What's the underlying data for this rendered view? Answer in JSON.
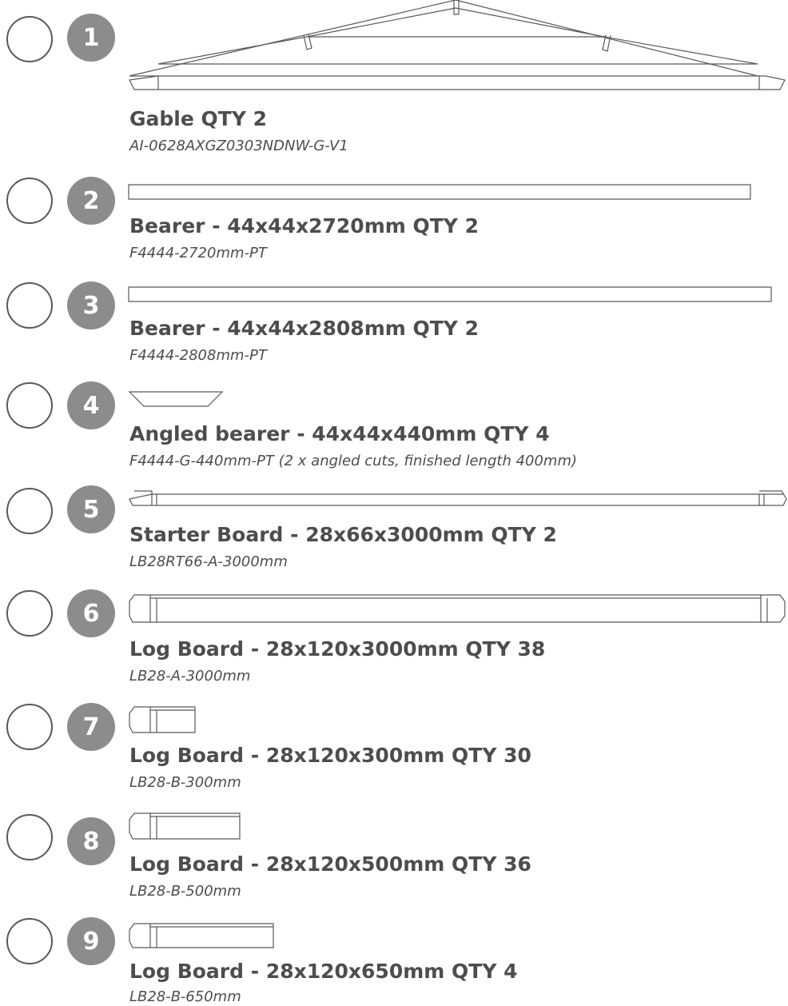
{
  "items": [
    {
      "number": "1",
      "title": "Gable QTY 2",
      "code": "AI-0628AXGZ0303NDNW-G-V1"
    },
    {
      "number": "2",
      "title": "Bearer - 44x44x2720mm QTY 2",
      "code": "F4444-2720mm-PT"
    },
    {
      "number": "3",
      "title": "Bearer - 44x44x2808mm QTY 2",
      "code": "F4444-2808mm-PT"
    },
    {
      "number": "4",
      "title": "Angled bearer - 44x44x440mm QTY 4",
      "code": "F4444-G-440mm-PT (2 x angled cuts, finished length 400mm)"
    },
    {
      "number": "5",
      "title": "Starter Board - 28x66x3000mm QTY 2",
      "code": "LB28RT66-A-3000mm"
    },
    {
      "number": "6",
      "title": "Log Board - 28x120x3000mm QTY 38",
      "code": "LB28-A-3000mm"
    },
    {
      "number": "7",
      "title": "Log Board - 28x120x300mm QTY 30",
      "code": "LB28-B-300mm"
    },
    {
      "number": "8",
      "title": "Log Board - 28x120x500mm QTY 36",
      "code": "LB28-B-500mm"
    },
    {
      "number": "9",
      "title": "Log Board - 28x120x650mm QTY 4",
      "code": "LB28-B-650mm"
    }
  ]
}
